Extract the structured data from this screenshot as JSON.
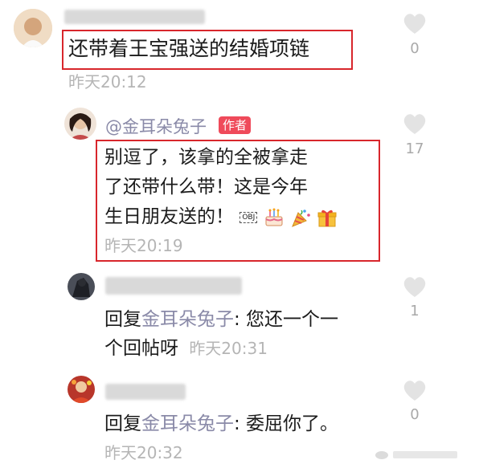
{
  "comments": [
    {
      "text": "还带着王宝强送的结婚项链",
      "time": "昨天20:12",
      "likes": "0"
    },
    {
      "author": "@金耳朵兔子",
      "author_badge": "作者",
      "text_line1": "别逗了，该拿的全被拿走",
      "text_line2": "了还带什么带！这是今年",
      "text_line3": "生日朋友送的！",
      "obj_glyph": "OBJ",
      "emoji": [
        "cake-icon",
        "party-popper-icon",
        "gift-icon"
      ],
      "time": "昨天20:19",
      "likes": "17"
    },
    {
      "reply_prefix": "回复",
      "reply_to": "金耳朵兔子",
      "text_line1": ": 您还一个一",
      "text_line2": "个回帖呀",
      "time": "昨天20:31",
      "likes": "1"
    },
    {
      "reply_prefix": "回复",
      "reply_to": "金耳朵兔子",
      "text": ": 委屈你了。",
      "time": "昨天20:32",
      "likes": "0"
    }
  ],
  "colors": {
    "highlight_box": "#d8262c",
    "link": "#8a8aa8",
    "badge": "#ef4a5a"
  }
}
